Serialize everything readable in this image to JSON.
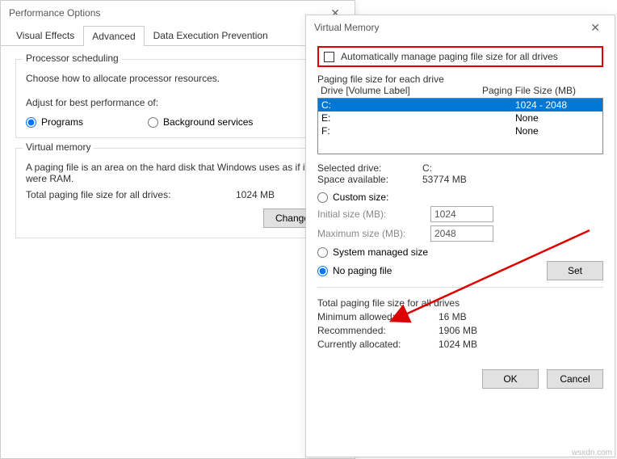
{
  "perf": {
    "title": "Performance Options",
    "tabs": [
      "Visual Effects",
      "Advanced",
      "Data Execution Prevention"
    ],
    "active_tab": 1,
    "processor_scheduling": {
      "title": "Processor scheduling",
      "desc": "Choose how to allocate processor resources.",
      "adjust_label": "Adjust for best performance of:",
      "programs": "Programs",
      "background": "Background services"
    },
    "virtual_memory": {
      "title": "Virtual memory",
      "desc": "A paging file is an area on the hard disk that Windows uses as if it were RAM.",
      "total_label": "Total paging file size for all drives:",
      "total_value": "1024 MB",
      "change_btn": "Change..."
    }
  },
  "vm": {
    "title": "Virtual Memory",
    "auto_manage": "Automatically manage paging file size for all drives",
    "paging_group": "Paging file size for each drive",
    "header_drive": "Drive  [Volume Label]",
    "header_size": "Paging File Size (MB)",
    "drives": [
      {
        "label": "C:",
        "size": "1024 - 2048",
        "selected": true
      },
      {
        "label": "E:",
        "size": "None",
        "selected": false
      },
      {
        "label": "F:",
        "size": "None",
        "selected": false
      }
    ],
    "selected_drive_label": "Selected drive:",
    "selected_drive_value": "C:",
    "space_label": "Space available:",
    "space_value": "53774 MB",
    "custom_size": "Custom size:",
    "initial_label": "Initial size (MB):",
    "initial_value": "1024",
    "max_label": "Maximum size (MB):",
    "max_value": "2048",
    "system_managed": "System managed size",
    "no_paging": "No paging file",
    "set_btn": "Set",
    "totals_title": "Total paging file size for all drives",
    "min_label": "Minimum allowed:",
    "min_value": "16 MB",
    "rec_label": "Recommended:",
    "rec_value": "1906 MB",
    "cur_label": "Currently allocated:",
    "cur_value": "1024 MB",
    "ok": "OK",
    "cancel": "Cancel"
  },
  "watermark": "wsxdn.com"
}
